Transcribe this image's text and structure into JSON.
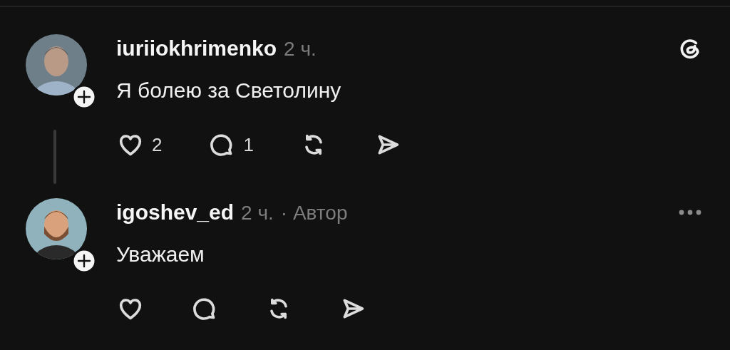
{
  "posts": [
    {
      "username": "iuriiokhrimenko",
      "time": "2 ч.",
      "text": "Я болею за Светолину",
      "has_logo": true,
      "has_menu": false,
      "thread_line": true,
      "actions": [
        {
          "kind": "like",
          "count": "2"
        },
        {
          "kind": "reply",
          "count": "1"
        },
        {
          "kind": "repost"
        },
        {
          "kind": "share"
        }
      ]
    },
    {
      "username": "igoshev_ed",
      "time": "2 ч.",
      "author_label": "· Автор",
      "text": "Уважаем",
      "has_logo": false,
      "has_menu": true,
      "thread_line": false,
      "actions": [
        {
          "kind": "like"
        },
        {
          "kind": "reply"
        },
        {
          "kind": "repost"
        },
        {
          "kind": "share"
        }
      ]
    }
  ]
}
